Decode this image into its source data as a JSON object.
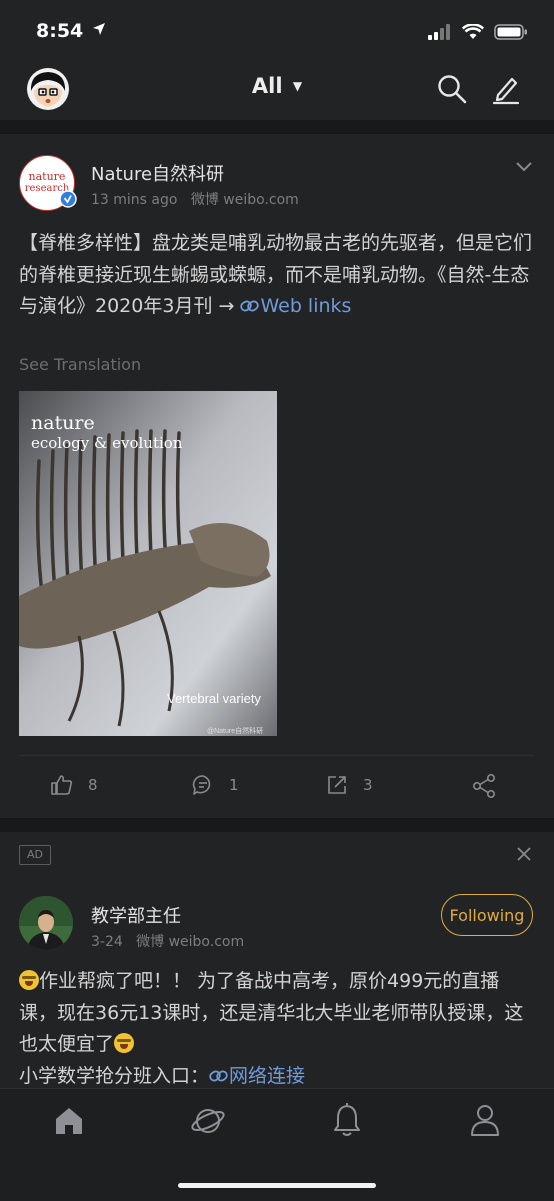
{
  "status_bar": {
    "time": "8:54"
  },
  "header": {
    "title": "All"
  },
  "post": {
    "author": "Nature自然科研",
    "logo_text_1": "nature",
    "logo_text_2": "research",
    "time": "13 mins ago",
    "source": "微博 weibo.com",
    "text_main": "【脊椎多样性】盘龙类是哺乳动物最古老的先驱者，但是它们的脊椎更接近现生蜥蜴或蝾螈，而不是哺乳动物。《自然-生态与演化》2020年3月刊 → ",
    "link_label": "Web links",
    "see_translation": "See Translation",
    "image": {
      "line1": "nature",
      "line2": "ecology & evolution",
      "caption": "Vertebral variety",
      "watermark": "@Nature自然科研"
    },
    "actions": {
      "likes": "8",
      "comments": "1",
      "reposts": "3"
    }
  },
  "ad": {
    "badge": "AD",
    "author": "教学部主任",
    "time": "3-24",
    "source": "微博 weibo.com",
    "follow_label": "Following",
    "text_a": "作业帮疯了吧！！ 为了备战中高考，原价499元的直播课，现在36元13课时，还是清华北大毕业老师带队授课，这也太便宜了",
    "text_b": "小学数学抢分班入口：",
    "link_label": "网络连接"
  },
  "colors": {
    "accent_link": "#6f9bd8",
    "follow": "#e0ad3e",
    "background": "#222325"
  }
}
